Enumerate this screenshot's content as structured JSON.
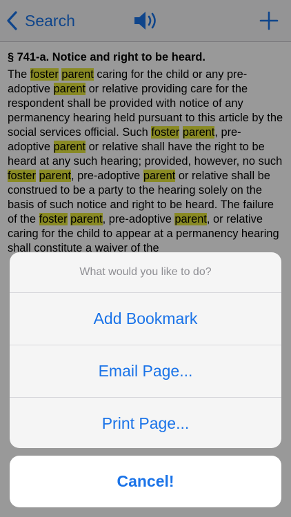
{
  "nav": {
    "back_label": "Search",
    "back_icon": "chevron-left-icon",
    "speaker_icon": "speaker-icon",
    "add_icon": "plus-icon",
    "accent": "#1a73e8"
  },
  "document": {
    "heading": "§ 741-a. Notice and right to be heard.",
    "highlight_color": "#e4e63c",
    "segments": [
      {
        "text": "The ",
        "hl": false
      },
      {
        "text": "foster",
        "hl": true
      },
      {
        "text": " ",
        "hl": false
      },
      {
        "text": "parent",
        "hl": true
      },
      {
        "text": " caring for the child or any pre-adoptive ",
        "hl": false
      },
      {
        "text": "parent",
        "hl": true
      },
      {
        "text": " or relative providing care for the respondent shall be provided with notice of any permanency hearing held pursuant to this article by the social services official. Such ",
        "hl": false
      },
      {
        "text": "foster",
        "hl": true
      },
      {
        "text": " ",
        "hl": false
      },
      {
        "text": "parent",
        "hl": true
      },
      {
        "text": ", pre-adoptive ",
        "hl": false
      },
      {
        "text": "parent",
        "hl": true
      },
      {
        "text": " or relative shall have the right to be heard at any such hearing; provided, however, no such ",
        "hl": false
      },
      {
        "text": "foster",
        "hl": true
      },
      {
        "text": " ",
        "hl": false
      },
      {
        "text": "parent",
        "hl": true
      },
      {
        "text": ", pre-adoptive ",
        "hl": false
      },
      {
        "text": "parent",
        "hl": true
      },
      {
        "text": " or relative shall be construed to be a party to the hearing solely on the basis of such notice and right to be heard. The failure of the ",
        "hl": false
      },
      {
        "text": "foster",
        "hl": true
      },
      {
        "text": " ",
        "hl": false
      },
      {
        "text": "parent",
        "hl": true
      },
      {
        "text": ", pre-adoptive ",
        "hl": false
      },
      {
        "text": "parent",
        "hl": true
      },
      {
        "text": ", or relative caring for the child to appear at a permanency hearing shall constitute a waiver of the",
        "hl": false
      }
    ]
  },
  "action_sheet": {
    "title": "What would you like to do?",
    "buttons": [
      "Add Bookmark",
      "Email Page...",
      "Print Page..."
    ],
    "cancel_label": "Cancel!"
  }
}
